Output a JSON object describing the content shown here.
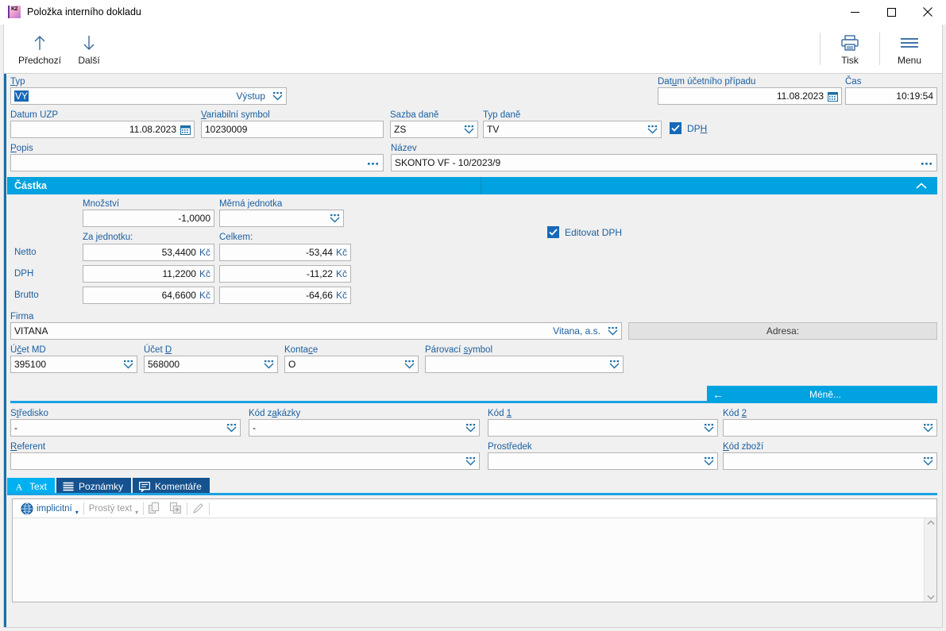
{
  "window": {
    "title": "Položka interního dokladu",
    "app_icon": "K2",
    "minimize": "minimize-icon",
    "maximize": "maximize-icon",
    "close": "close-icon"
  },
  "ribbon": {
    "prev": {
      "label": "Předchozí",
      "icon": "arrow-up-icon"
    },
    "next": {
      "label": "Další",
      "icon": "arrow-down-icon"
    },
    "print": {
      "label": "Tisk",
      "icon": "printer-icon"
    },
    "menu": {
      "label": "Menu",
      "icon": "hamburger-icon"
    }
  },
  "form": {
    "typ": {
      "label": "Typ",
      "value": "VY",
      "right_text": "Výstup"
    },
    "datum_uct": {
      "label": "Datum účetního případu",
      "value": "11.08.2023"
    },
    "cas": {
      "label": "Čas",
      "value": "10:19:54"
    },
    "datum_uzp": {
      "label": "Datum UZP",
      "value": "11.08.2023"
    },
    "variabilni_symbol": {
      "label": "Variabilní symbol",
      "value": "10230009"
    },
    "sazba_dane": {
      "label": "Sazba daně",
      "value": "ZS"
    },
    "typ_dane": {
      "label": "Typ daně",
      "value": "TV"
    },
    "dph_checkbox": {
      "label": "DPH",
      "checked": true
    },
    "popis": {
      "label": "Popis",
      "value": ""
    },
    "nazev": {
      "label": "Název",
      "value": "SKONTO VF - 10/2023/9"
    }
  },
  "castka": {
    "header": "Částka",
    "mnozstvi": {
      "label": "Množství",
      "value": "-1,0000"
    },
    "merna_jednotka": {
      "label": "Měrná jednotka",
      "value": ""
    },
    "col_unit": "Za jednotku:",
    "col_total": "Celkem:",
    "editovat_dph": {
      "label": "Editovat DPH",
      "checked": true
    },
    "rows": [
      {
        "label": "Netto",
        "unit": "53,4400",
        "unit_cur": "Kč",
        "total": "-53,44",
        "total_cur": "Kč"
      },
      {
        "label": "DPH",
        "unit": "11,2200",
        "unit_cur": "Kč",
        "total": "-11,22",
        "total_cur": "Kč"
      },
      {
        "label": "Brutto",
        "unit": "64,6600",
        "unit_cur": "Kč",
        "total": "-64,66",
        "total_cur": "Kč"
      }
    ]
  },
  "firma": {
    "label": "Firma",
    "value": "VITANA",
    "right_text": "Vitana, a.s.",
    "adresa_label": "Adresa:"
  },
  "ucty": {
    "ucet_md": {
      "label": "Účet MD",
      "value": "395100"
    },
    "ucet_d": {
      "label": "Účet D",
      "value": "568000"
    },
    "kontace": {
      "label": "Kontace",
      "value": "O"
    },
    "parovaci_symbol": {
      "label": "Párovací symbol",
      "value": ""
    }
  },
  "more_button": {
    "label": "Méně...",
    "icon": "arrow-left-icon"
  },
  "codes": {
    "stredisko": {
      "label": "Středisko",
      "value": "-"
    },
    "kod_zakazky": {
      "label": "Kód zakázky",
      "value": "-"
    },
    "kod_1": {
      "label": "Kód 1",
      "value": ""
    },
    "kod_2": {
      "label": "Kód 2",
      "value": ""
    },
    "referent": {
      "label": "Referent",
      "value": ""
    },
    "prostredek": {
      "label": "Prostředek",
      "value": ""
    },
    "kod_zbozi": {
      "label": "Kód zboží",
      "value": ""
    }
  },
  "tabs": [
    {
      "label": "Text",
      "icon": "letter-a-icon",
      "active": true
    },
    {
      "label": "Poznámky",
      "icon": "lines-icon",
      "active": false
    },
    {
      "label": "Komentáře",
      "icon": "speech-bubble-icon",
      "active": false
    }
  ],
  "editor": {
    "style_name": "implicitní",
    "style_icon": "globe-icon",
    "format_name": "Prostý text",
    "copy_icon": "copy-icon",
    "copy_add_icon": "copy-add-icon",
    "edit_icon": "pencil-icon",
    "content": ""
  },
  "colors": {
    "accent_cyan": "#00a2e0",
    "accent_blue": "#1669b8",
    "label_blue": "#1a5fa0",
    "tab_inactive": "#15528f",
    "window_bg": "#f0f0f0"
  }
}
